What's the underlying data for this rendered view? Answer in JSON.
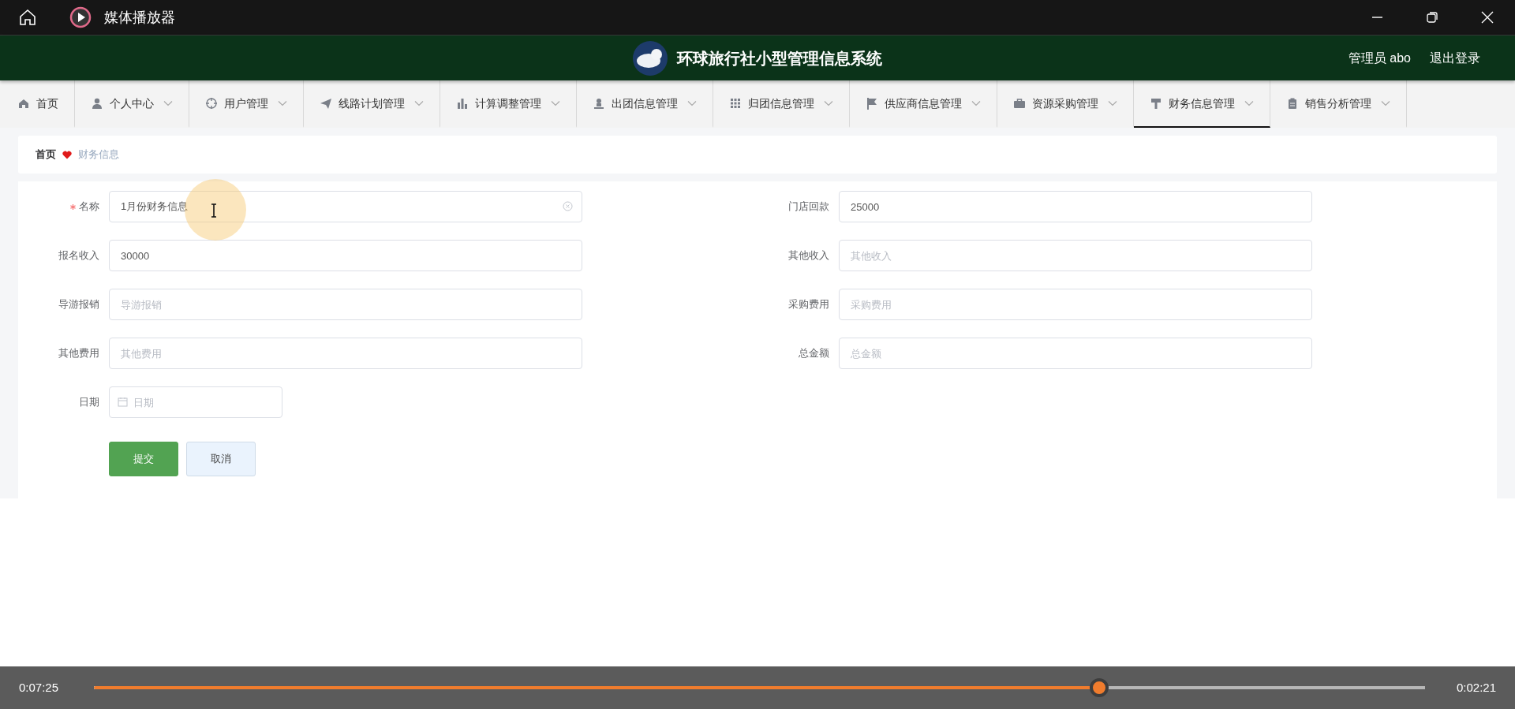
{
  "window": {
    "title": "媒体播放器"
  },
  "header": {
    "title": "环球旅行社小型管理信息系统",
    "user": "管理员 abo",
    "logout": "退出登录"
  },
  "nav": [
    {
      "label": "首页",
      "dropdown": false,
      "selected": false
    },
    {
      "label": "个人中心",
      "dropdown": true,
      "selected": false
    },
    {
      "label": "用户管理",
      "dropdown": true,
      "selected": false
    },
    {
      "label": "线路计划管理",
      "dropdown": true,
      "selected": false
    },
    {
      "label": "计算调整管理",
      "dropdown": true,
      "selected": false
    },
    {
      "label": "出团信息管理",
      "dropdown": true,
      "selected": false
    },
    {
      "label": "归团信息管理",
      "dropdown": true,
      "selected": false
    },
    {
      "label": "供应商信息管理",
      "dropdown": true,
      "selected": false
    },
    {
      "label": "资源采购管理",
      "dropdown": true,
      "selected": false
    },
    {
      "label": "财务信息管理",
      "dropdown": true,
      "selected": true
    },
    {
      "label": "销售分析管理",
      "dropdown": true,
      "selected": false
    }
  ],
  "breadcrumb": [
    "首页",
    "财务信息"
  ],
  "form": {
    "rows": [
      [
        {
          "label": "名称",
          "required": true,
          "kind": "text",
          "value": "1月份财务信息",
          "clearable": true
        },
        {
          "label": "门店回款",
          "required": false,
          "kind": "text",
          "value": "25000",
          "clearable": false
        }
      ],
      [
        {
          "label": "报名收入",
          "required": false,
          "kind": "text",
          "value": "30000",
          "clearable": false
        },
        {
          "label": "其他收入",
          "required": false,
          "kind": "text",
          "placeholder": "其他收入",
          "clearable": false
        }
      ],
      [
        {
          "label": "导游报销",
          "required": false,
          "kind": "text",
          "placeholder": "导游报销",
          "clearable": false
        },
        {
          "label": "采购费用",
          "required": false,
          "kind": "text",
          "placeholder": "采购费用",
          "clearable": false
        }
      ],
      [
        {
          "label": "其他费用",
          "required": false,
          "kind": "text",
          "placeholder": "其他费用",
          "clearable": false
        },
        {
          "label": "总金额",
          "required": false,
          "kind": "text",
          "placeholder": "总金额",
          "clearable": false
        }
      ],
      [
        {
          "label": "日期",
          "required": false,
          "kind": "date",
          "placeholder": "日期",
          "clearable": false
        }
      ]
    ],
    "buttons": [
      {
        "label": "提交",
        "kind": "primary"
      },
      {
        "label": "取消",
        "kind": "secondary"
      }
    ]
  },
  "player": {
    "elapsed": "0:07:25",
    "remaining": "0:02:21",
    "level": 0.755
  }
}
